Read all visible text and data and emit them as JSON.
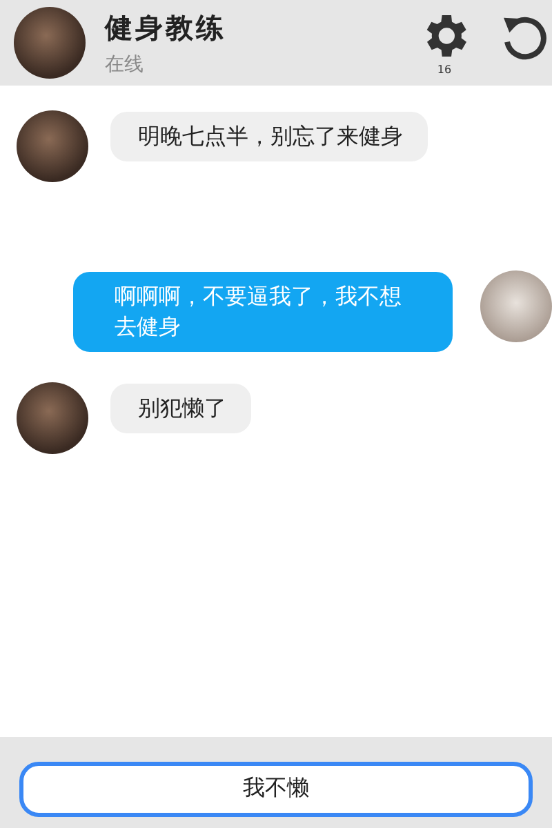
{
  "contact": {
    "name": "健身教练",
    "status": "在线"
  },
  "settings_badge": "16",
  "messages": [
    {
      "kind": "incoming",
      "text": "明晚七点半，别忘了来健身"
    },
    {
      "kind": "outgoing",
      "text": "啊啊啊，不要逼我了，我不想去健身"
    },
    {
      "kind": "incoming",
      "text": "别犯懒了"
    }
  ],
  "action_button": "我不懒"
}
